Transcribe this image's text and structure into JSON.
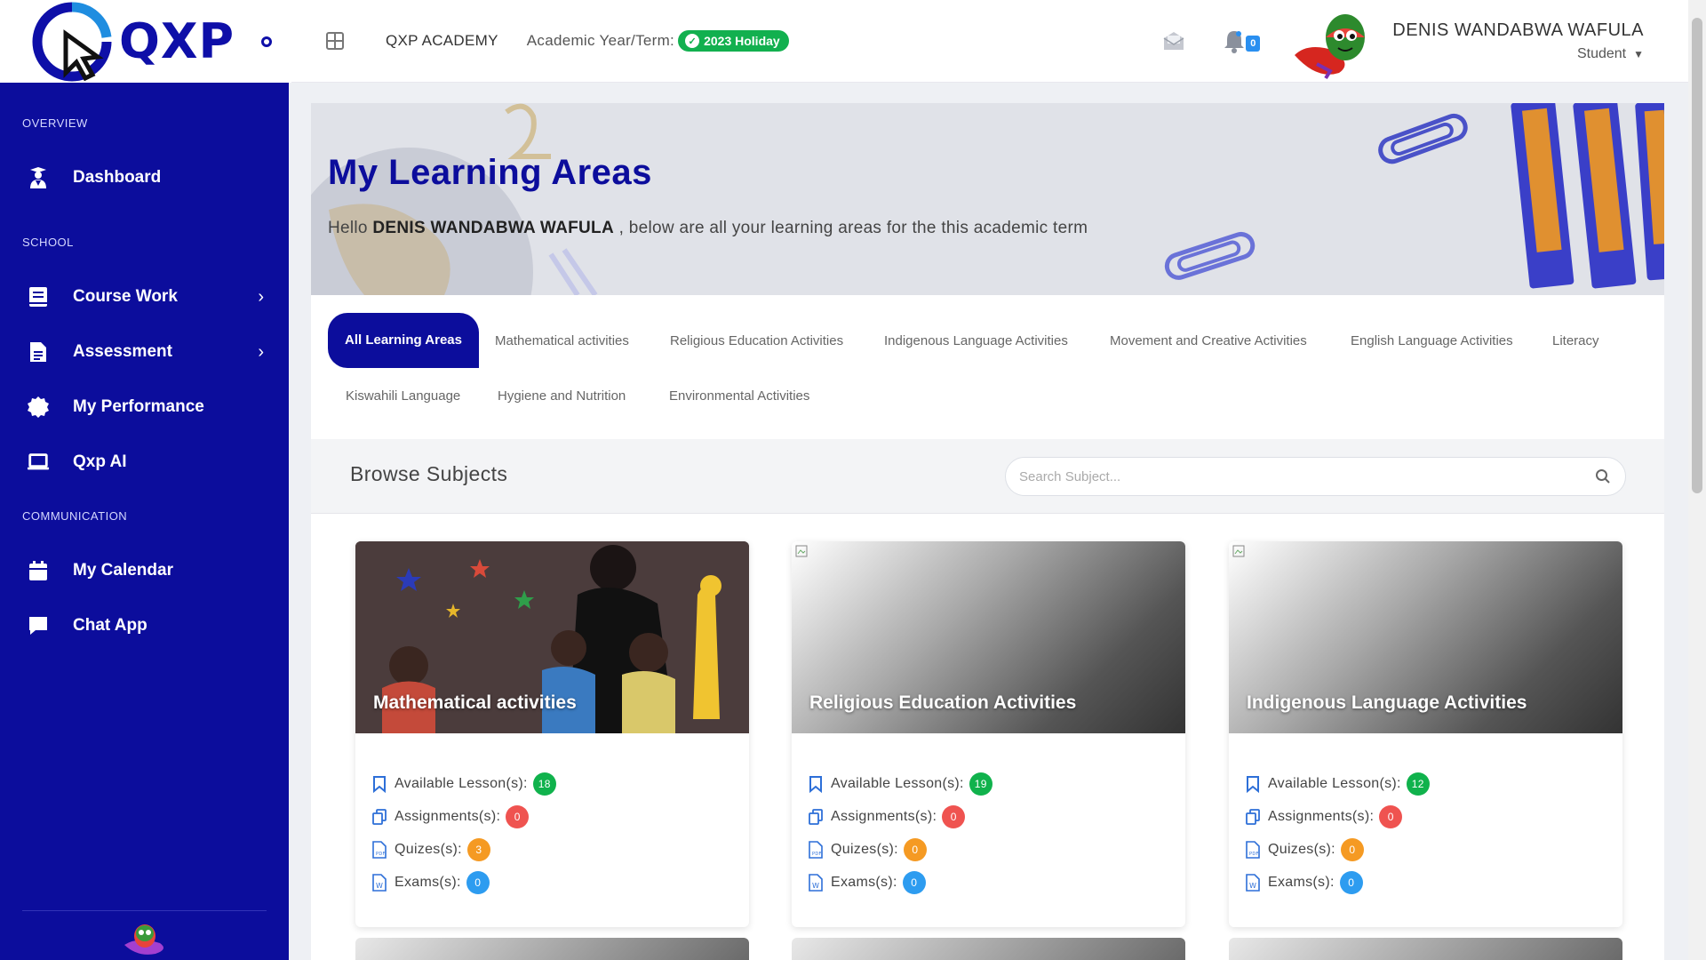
{
  "brand": {
    "name": "QXP"
  },
  "sidebar": {
    "sections": {
      "overview": "OVERVIEW",
      "school": "SCHOOL",
      "communication": "COMMUNICATION"
    },
    "items": [
      {
        "label": "Dashboard",
        "icon": "graduate-icon"
      },
      {
        "label": "Course Work",
        "icon": "book-icon"
      },
      {
        "label": "Assessment",
        "icon": "document-icon"
      },
      {
        "label": "My Performance",
        "icon": "badge-icon"
      },
      {
        "label": "Qxp AI",
        "icon": "laptop-icon"
      },
      {
        "label": "My Calendar",
        "icon": "calendar-icon"
      },
      {
        "label": "Chat App",
        "icon": "chat-icon"
      }
    ],
    "chevron": "›"
  },
  "header": {
    "academy": "QXP ACADEMY",
    "term_label": "Academic Year/Term:",
    "term_badge": "2023 Holiday",
    "notification_count": "0",
    "user_name": "DENIS WANDABWA WAFULA",
    "user_role": "Student"
  },
  "banner": {
    "title": "My Learning Areas",
    "greeting_prefix": "Hello",
    "student_name": "DENIS WANDABWA WAFULA",
    "greeting_suffix": ", below are all your learning areas for the this academic term"
  },
  "tabs": [
    "All Learning Areas",
    "Mathematical activities",
    "Religious Education Activities",
    "Indigenous Language Activities",
    "Movement and Creative Activities",
    "English Language Activities",
    "Literacy",
    "Kiswahili Language",
    "Hygiene and Nutrition",
    "Environmental Activities"
  ],
  "browse": {
    "title": "Browse Subjects",
    "search_placeholder": "Search Subject..."
  },
  "stat_labels": {
    "lessons": "Available Lesson(s):",
    "assignments": "Assignments(s):",
    "quizzes": "Quizes(s):",
    "exams": "Exams(s):"
  },
  "cards": [
    {
      "title": "Mathematical activities",
      "lessons": "18",
      "assignments": "0",
      "quizzes": "3",
      "exams": "0"
    },
    {
      "title": "Religious Education Activities",
      "lessons": "19",
      "assignments": "0",
      "quizzes": "0",
      "exams": "0"
    },
    {
      "title": "Indigenous Language Activities",
      "lessons": "12",
      "assignments": "0",
      "quizzes": "0",
      "exams": "0"
    }
  ],
  "colors": {
    "sidebar": "#0c0d9c",
    "accent": "#0e0fa8",
    "success": "#10b24c",
    "danger": "#ef5350",
    "warning": "#f59a23",
    "info": "#2d9cf0"
  }
}
